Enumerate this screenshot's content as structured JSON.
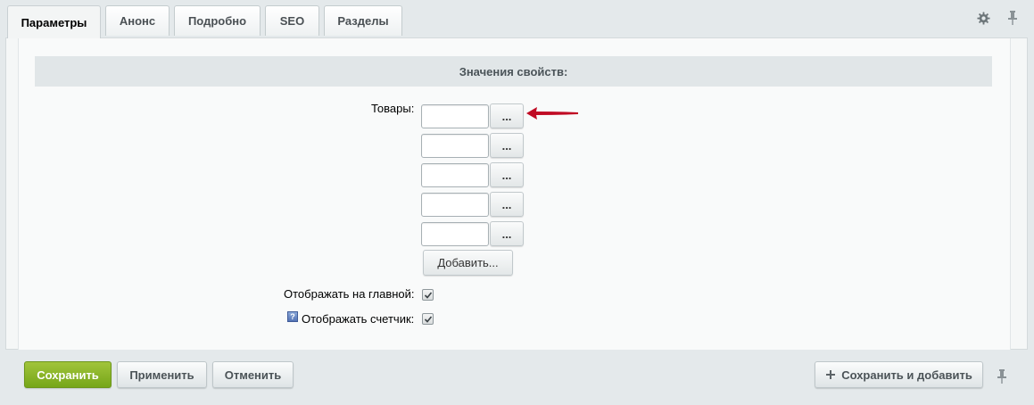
{
  "tabs": [
    {
      "label": "Параметры",
      "active": true
    },
    {
      "label": "Анонс",
      "active": false
    },
    {
      "label": "Подробно",
      "active": false
    },
    {
      "label": "SEO",
      "active": false
    },
    {
      "label": "Разделы",
      "active": false
    }
  ],
  "section": {
    "title": "Значения свойств:"
  },
  "properties": {
    "products_label": "Товары:",
    "product_inputs": [
      "",
      "",
      "",
      "",
      ""
    ],
    "browse_button_label": "...",
    "add_button_label": "Добавить...",
    "show_on_main_label": "Отображать на главной:",
    "show_on_main_checked": true,
    "show_counter_label": "Отображать счетчик:",
    "show_counter_checked": true
  },
  "footer": {
    "save_label": "Сохранить",
    "apply_label": "Применить",
    "cancel_label": "Отменить",
    "save_and_add_label": "Сохранить и добавить"
  },
  "icons": {
    "settings": "gear-icon",
    "pin": "pin-icon",
    "help": "help-icon",
    "plus": "plus-icon",
    "arrow": "arrow-left-icon"
  },
  "colors": {
    "accent_green": "#8ab42a",
    "arrow_red": "#c00a23"
  }
}
